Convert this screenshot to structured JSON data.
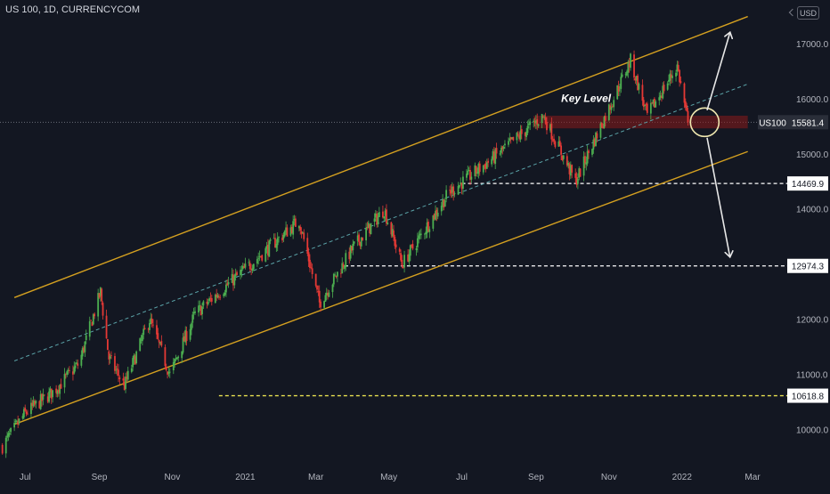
{
  "header": {
    "symbol_title": "US 100, 1D, CURRENCYCOM",
    "currency": "USD"
  },
  "colors": {
    "background": "#131722",
    "up": "#26a69a",
    "up_candle": "#4caf50",
    "down_candle": "#e53935",
    "channel": "#d4a020",
    "midline": "#5ba3a8",
    "zone": "#8b1a1a",
    "arrow": "#e8e8e8",
    "dashed_level": "#ffffff",
    "level_yellow": "#e8e050"
  },
  "chart_data": {
    "type": "candlestick",
    "title": "US 100, 1D, CURRENCYCOM",
    "x_tick_labels": [
      "Jul",
      "Sep",
      "Nov",
      "2021",
      "Mar",
      "May",
      "Jul",
      "Sep",
      "Nov",
      "2022",
      "Mar"
    ],
    "y_tick_labels": [
      "10000.0",
      "11000.0",
      "12000.0",
      "13000.0",
      "14000.0",
      "15000.0",
      "16000.0",
      "17000.0"
    ],
    "ylim": [
      9400,
      17800
    ],
    "xlim": [
      "2020-06-10",
      "2022-03-30"
    ],
    "grid": false,
    "price_path": [
      {
        "date": "2020-06-12",
        "close": 9700
      },
      {
        "date": "2020-07-01",
        "close": 10300
      },
      {
        "date": "2020-07-25",
        "close": 10700
      },
      {
        "date": "2020-08-15",
        "close": 11200
      },
      {
        "date": "2020-09-02",
        "close": 12500
      },
      {
        "date": "2020-09-09",
        "close": 11300
      },
      {
        "date": "2020-09-22",
        "close": 10800
      },
      {
        "date": "2020-10-13",
        "close": 12000
      },
      {
        "date": "2020-10-30",
        "close": 11000
      },
      {
        "date": "2020-11-20",
        "close": 12100
      },
      {
        "date": "2020-12-31",
        "close": 12900
      },
      {
        "date": "2021-02-15",
        "close": 13800
      },
      {
        "date": "2021-03-04",
        "close": 12300
      },
      {
        "date": "2021-04-01",
        "close": 13300
      },
      {
        "date": "2021-04-27",
        "close": 14000
      },
      {
        "date": "2021-05-12",
        "close": 13000
      },
      {
        "date": "2021-06-20",
        "close": 14300
      },
      {
        "date": "2021-07-31",
        "close": 15000
      },
      {
        "date": "2021-09-07",
        "close": 15700
      },
      {
        "date": "2021-10-04",
        "close": 14500
      },
      {
        "date": "2021-11-19",
        "close": 16700
      },
      {
        "date": "2021-12-03",
        "close": 15700
      },
      {
        "date": "2021-12-28",
        "close": 16600
      },
      {
        "date": "2022-01-06",
        "close": 15581.4
      }
    ],
    "current_price": {
      "symbol": "US100",
      "value": 15581.4,
      "label": "15581.4"
    },
    "horizontal_levels": [
      {
        "value": 14469.9,
        "label": "14469.9",
        "color": "white",
        "from": "2021-07-01"
      },
      {
        "value": 12974.3,
        "label": "12974.3",
        "color": "white",
        "from": "2021-03-25"
      },
      {
        "value": 10618.8,
        "label": "10618.8",
        "color": "yellow",
        "from": "2020-12-10"
      }
    ],
    "channel": {
      "upper": [
        [
          "2020-06-22",
          12400
        ],
        [
          "2022-02-25",
          17500
        ]
      ],
      "lower": [
        [
          "2020-06-22",
          10100
        ],
        [
          "2022-02-25",
          15050
        ]
      ],
      "mid": [
        [
          "2020-06-22",
          11250
        ],
        [
          "2022-02-25",
          16275
        ]
      ]
    },
    "key_level": {
      "label": "Key Level",
      "range": [
        15470,
        15700
      ],
      "from": "2021-08-30",
      "to": "2022-02-25"
    },
    "annotations": [
      {
        "type": "circle",
        "at": [
          "2022-01-20",
          15581.4
        ]
      },
      {
        "type": "arrow",
        "from": [
          "2022-01-22",
          15800
        ],
        "to": [
          "2022-02-10",
          17200
        ]
      },
      {
        "type": "arrow",
        "from": [
          "2022-01-22",
          15300
        ],
        "to": [
          "2022-02-10",
          13150
        ]
      }
    ]
  }
}
